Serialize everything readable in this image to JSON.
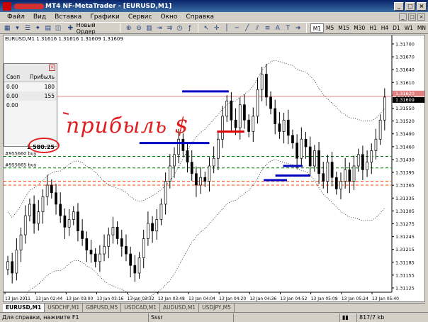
{
  "window": {
    "title": "MT4 NF-MetaTrader - [EURUSD,M1]",
    "buttons": [
      "_",
      "□",
      "×"
    ]
  },
  "menu": {
    "items": [
      "Файл",
      "Вид",
      "Вставка",
      "Графики",
      "Сервис",
      "Окно",
      "Справка"
    ]
  },
  "toolbar": {
    "new_order_label": "Новый Ордер",
    "timeframes": [
      "M1",
      "M5",
      "M15",
      "M30",
      "H1",
      "H4",
      "D1",
      "W1",
      "MN"
    ],
    "active_timeframe": "M1",
    "icons": [
      "new-chart-icon",
      "profiles-icon",
      "market-watch-icon",
      "navigator-icon",
      "terminal-icon",
      "tester-icon",
      "new-order-icon",
      "zoom-in-icon",
      "zoom-out-icon",
      "tile-icon",
      "chart-shift-icon",
      "autoscroll-icon",
      "periods-icon",
      "indicators-icon",
      "crosshair-icon",
      "cursor-icon",
      "vertical-line-icon",
      "horizontal-line-icon",
      "trendline-icon",
      "channel-icon",
      "fibo-icon",
      "text-icon",
      "label-icon",
      "arrow-icon"
    ]
  },
  "chart": {
    "symbol_info": "EURUSD,M1  1.31616 1.31616 1.31609 1.31609",
    "price_label_current": "1.31609",
    "price_label_ask": "1.31620"
  },
  "chart_data": {
    "type": "candlestick",
    "title": "",
    "ylim": [
      1.311,
      1.3176
    ],
    "y_ticks": [
      "1.31700",
      "1.31670",
      "1.31640",
      "1.31610",
      "1.31580",
      "1.31550",
      "1.31520",
      "1.31490",
      "1.31460",
      "1.31430",
      "1.31395",
      "1.31365",
      "1.31335",
      "1.31305",
      "1.31275",
      "1.31245",
      "1.31215",
      "1.31185",
      "1.31155",
      "1.31125"
    ],
    "x_ticks": [
      "13 Jan 2011",
      "13 Jan 02:44",
      "13 Jan 03:00",
      "13 Jan 03:16",
      "13 Jan 03:32",
      "13 Jan 03:48",
      "13 Jan 04:04",
      "13 Jan 04:20",
      "13 Jan 04:36",
      "13 Jan 04:52",
      "13 Jan 05:08",
      "13 Jan 05:24",
      "13 Jan 05:40"
    ],
    "close": [
      1.3118,
      1.3115,
      1.3121,
      1.3125,
      1.313,
      1.3133,
      1.3128,
      1.3131,
      1.3135,
      1.3138,
      1.3136,
      1.3133,
      1.313,
      1.3127,
      1.3129,
      1.3131,
      1.3126,
      1.3124,
      1.3121,
      1.312,
      1.3118,
      1.312,
      1.3122,
      1.3125,
      1.3127,
      1.3124,
      1.3122,
      1.312,
      1.3117,
      1.3115,
      1.3119,
      1.3124,
      1.3128,
      1.3126,
      1.3129,
      1.3133,
      1.3139,
      1.3143,
      1.3146,
      1.315,
      1.3147,
      1.3144,
      1.3141,
      1.3138,
      1.314,
      1.3139,
      1.3143,
      1.3145,
      1.315,
      1.3156,
      1.316,
      1.3155,
      1.3153,
      1.3159,
      1.3155,
      1.3152,
      1.3156,
      1.3163,
      1.3167,
      1.3161,
      1.3158,
      1.3154,
      1.3152,
      1.3155,
      1.3151,
      1.3149,
      1.3145,
      1.315,
      1.3148,
      1.3143,
      1.3147,
      1.3141,
      1.3139,
      1.3144,
      1.314,
      1.3137,
      1.3139,
      1.3142,
      1.3139,
      1.3143,
      1.3146,
      1.3142,
      1.3144,
      1.3147,
      1.315,
      1.3155,
      1.3161
    ],
    "hlines": [
      {
        "label": "#955660 buy",
        "price": 1.31455,
        "color": "#008000",
        "style": "dashed"
      },
      {
        "label": "#955665 buy",
        "price": 1.31425,
        "color": "#008000",
        "style": "dashed"
      },
      {
        "label": "",
        "price": 1.3139,
        "color": "#ff4400",
        "style": "dashed"
      },
      {
        "label": "",
        "price": 1.3138,
        "color": "#ff4400",
        "style": "dashed"
      },
      {
        "label": "",
        "price": 1.31612,
        "color": "#e08080",
        "style": "solid"
      }
    ],
    "levels": [
      {
        "price": 1.31625,
        "x0": 0.46,
        "x1": 0.58,
        "color": "#0000c0"
      },
      {
        "price": 1.3149,
        "x0": 0.35,
        "x1": 0.53,
        "color": "#0000c0"
      },
      {
        "price": 1.3152,
        "x0": 0.55,
        "x1": 0.62,
        "color": "#e00000"
      },
      {
        "price": 1.31393,
        "x0": 0.67,
        "x1": 0.73,
        "color": "#0000c0"
      },
      {
        "price": 1.31405,
        "x0": 0.7,
        "x1": 0.79,
        "color": "#0000c0"
      },
      {
        "price": 1.3143,
        "x0": 0.72,
        "x1": 0.77,
        "color": "#0000c0"
      }
    ]
  },
  "terminal": {
    "columns": [
      "Своп",
      "Прибыль"
    ],
    "rows": [
      {
        "swap": "0.00",
        "profit": "180"
      },
      {
        "swap": "0.00",
        "profit": "155"
      },
      {
        "swap": "0.00",
        "profit": ""
      }
    ],
    "total": "1 580.25",
    "close_label": "×"
  },
  "annotation": {
    "text": "прибыль $",
    "color": "#e02020"
  },
  "tabs": {
    "items": [
      "EURUSD,M1",
      "USDCHF,M1",
      "GBPUSD,M5",
      "USDCAD,M1",
      "AUDUSD,M1",
      "USDJPY,M5"
    ],
    "active": "EURUSD,M1"
  },
  "status": {
    "help": "Для справки, нажмите F1",
    "profile": "Sssr",
    "traffic": "817/7 kb"
  }
}
